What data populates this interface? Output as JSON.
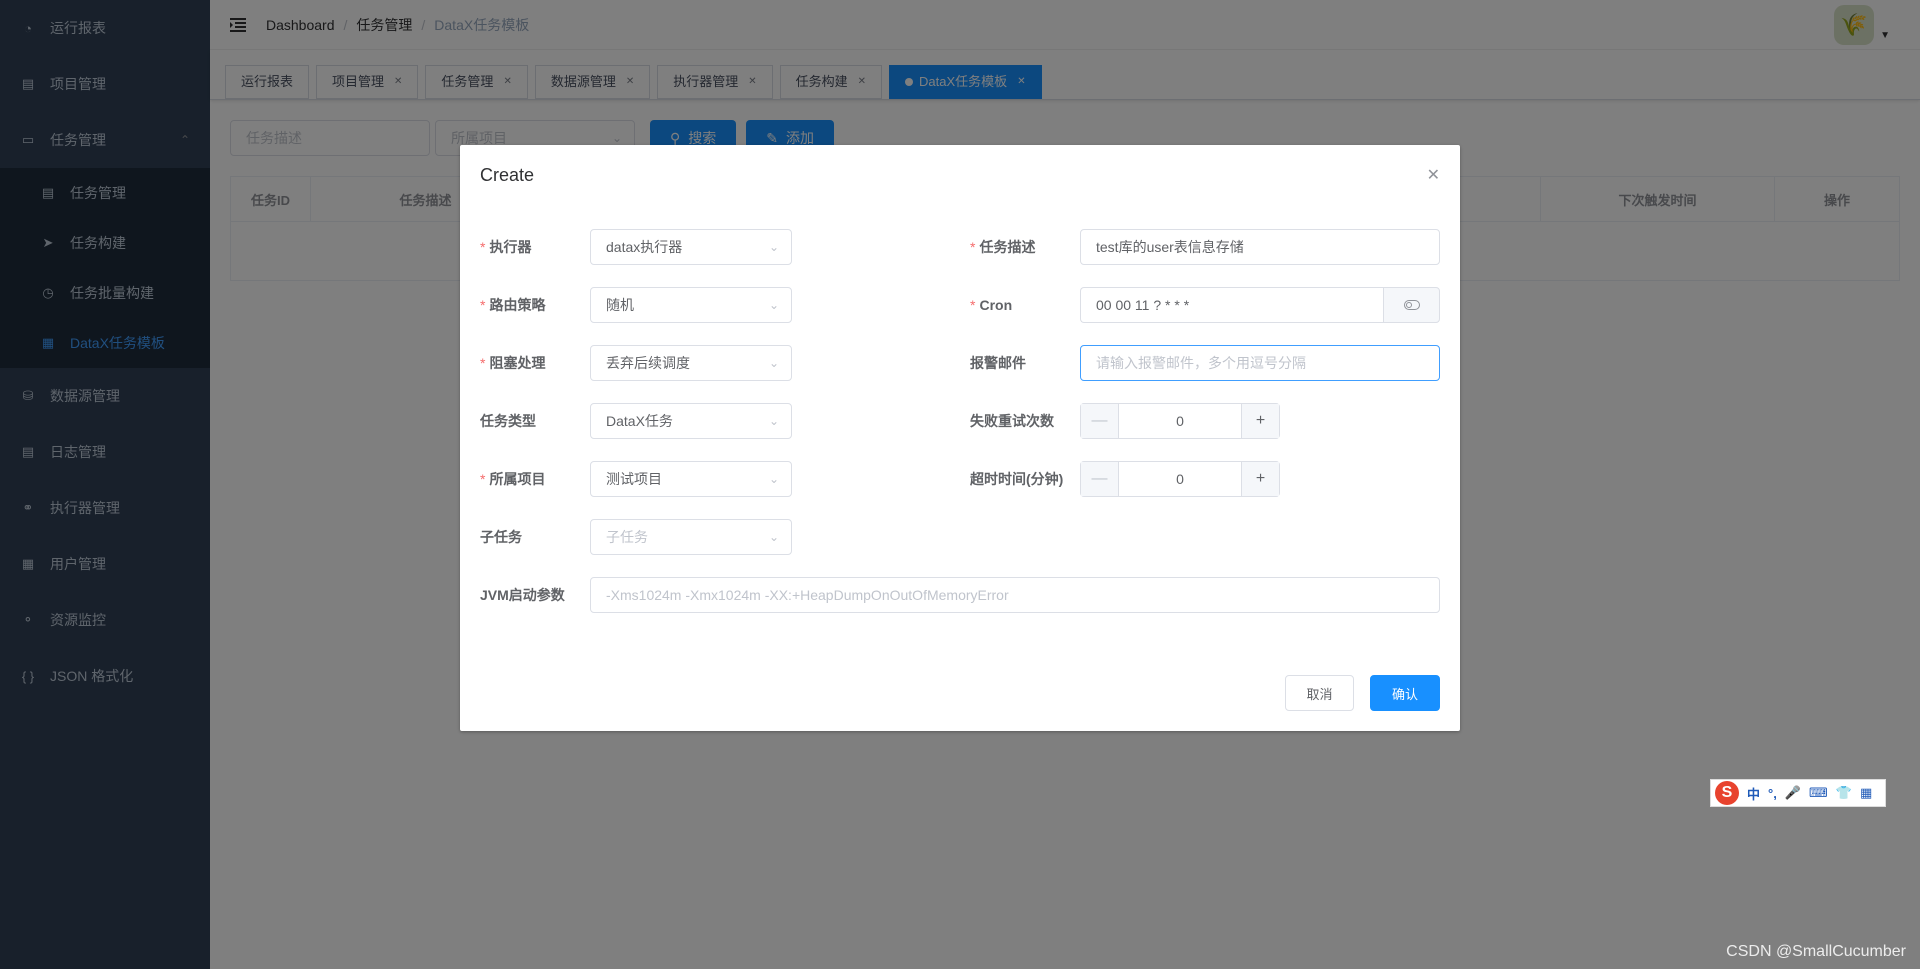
{
  "sidebar": {
    "items": [
      {
        "label": "运行报表",
        "icon": "dashboard-icon"
      },
      {
        "label": "项目管理",
        "icon": "project-icon"
      },
      {
        "label": "任务管理",
        "icon": "task-icon"
      },
      {
        "label": "数据源管理",
        "icon": "database-icon"
      },
      {
        "label": "日志管理",
        "icon": "log-icon"
      },
      {
        "label": "执行器管理",
        "icon": "executor-icon"
      },
      {
        "label": "用户管理",
        "icon": "user-icon"
      },
      {
        "label": "资源监控",
        "icon": "monitor-icon"
      },
      {
        "label": "JSON 格式化",
        "icon": "json-icon"
      }
    ],
    "submenu": [
      {
        "label": "任务管理",
        "icon": "task-list-icon"
      },
      {
        "label": "任务构建",
        "icon": "send-icon"
      },
      {
        "label": "任务批量构建",
        "icon": "batch-icon"
      },
      {
        "label": "DataX任务模板",
        "icon": "template-icon"
      }
    ],
    "active_color": "#409eff"
  },
  "breadcrumb": {
    "items": [
      "Dashboard",
      "任务管理",
      "DataX任务模板"
    ]
  },
  "tags": [
    {
      "label": "运行报表"
    },
    {
      "label": "项目管理"
    },
    {
      "label": "任务管理"
    },
    {
      "label": "数据源管理"
    },
    {
      "label": "执行器管理"
    },
    {
      "label": "任务构建"
    },
    {
      "label": "DataX任务模板"
    }
  ],
  "toolbar": {
    "desc_placeholder": "任务描述",
    "project_placeholder": "所属项目",
    "search_label": "搜索",
    "add_label": "添加"
  },
  "table": {
    "columns": [
      "任务ID",
      "任务描述",
      "下次触发时间",
      "操作"
    ]
  },
  "dialog": {
    "title": "Create",
    "fields": {
      "executor": {
        "label": "执行器",
        "value": "datax执行器"
      },
      "route": {
        "label": "路由策略",
        "value": "随机"
      },
      "block": {
        "label": "阻塞处理",
        "value": "丢弃后续调度"
      },
      "task_type": {
        "label": "任务类型",
        "value": "DataX任务"
      },
      "project": {
        "label": "所属项目",
        "value": "测试项目"
      },
      "child": {
        "label": "子任务",
        "placeholder": "子任务"
      },
      "jvm": {
        "label": "JVM启动参数",
        "placeholder": "-Xms1024m -Xmx1024m -XX:+HeapDumpOnOutOfMemoryError"
      },
      "desc": {
        "label": "任务描述",
        "value": "test库的user表信息存储"
      },
      "cron": {
        "label": "Cron",
        "value": "00 00 11 ? * * *"
      },
      "email": {
        "label": "报警邮件",
        "placeholder": "请输入报警邮件，多个用逗号分隔"
      },
      "retry": {
        "label": "失败重试次数",
        "value": "0"
      },
      "timeout": {
        "label": "超时时间(分钟)",
        "value": "0"
      }
    },
    "cancel_label": "取消",
    "confirm_label": "确认"
  },
  "ime": {
    "items": [
      "中",
      "°,"
    ]
  },
  "watermark": "CSDN @SmallCucumber",
  "colors": {
    "primary": "#1890ff",
    "sidebar_bg": "#304156",
    "submenu_bg": "#1f2d3d",
    "required": "#f56c6c"
  }
}
